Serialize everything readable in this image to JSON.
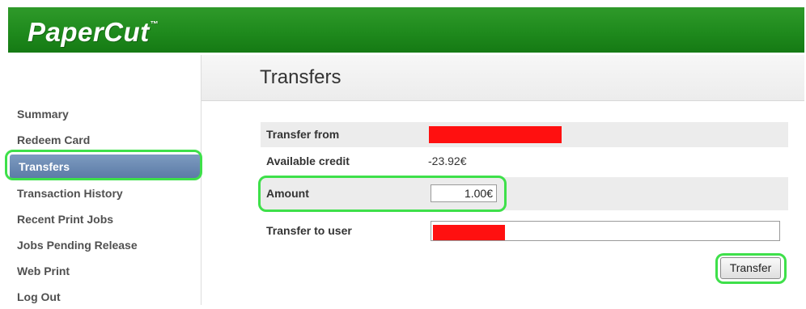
{
  "header": {
    "logo_text": "PaperCut",
    "logo_tm": "™"
  },
  "sidebar": {
    "items": [
      {
        "label": "Summary"
      },
      {
        "label": "Redeem Card"
      },
      {
        "label": "Transfers",
        "active": true
      },
      {
        "label": "Transaction History"
      },
      {
        "label": "Recent Print Jobs"
      },
      {
        "label": "Jobs Pending Release"
      },
      {
        "label": "Web Print"
      },
      {
        "label": "Log Out"
      }
    ]
  },
  "main": {
    "title": "Transfers",
    "form": {
      "transfer_from_label": "Transfer from",
      "available_credit_label": "Available credit",
      "available_credit_value": "-23.92€",
      "amount_label": "Amount",
      "amount_value": "1.00€",
      "transfer_to_label": "Transfer to user",
      "submit_label": "Transfer"
    }
  },
  "colors": {
    "header_green": "#1f8a1d",
    "active_nav": "#5b7aa6",
    "highlight_outline": "#3ee04a",
    "redaction": "#ff1010"
  }
}
